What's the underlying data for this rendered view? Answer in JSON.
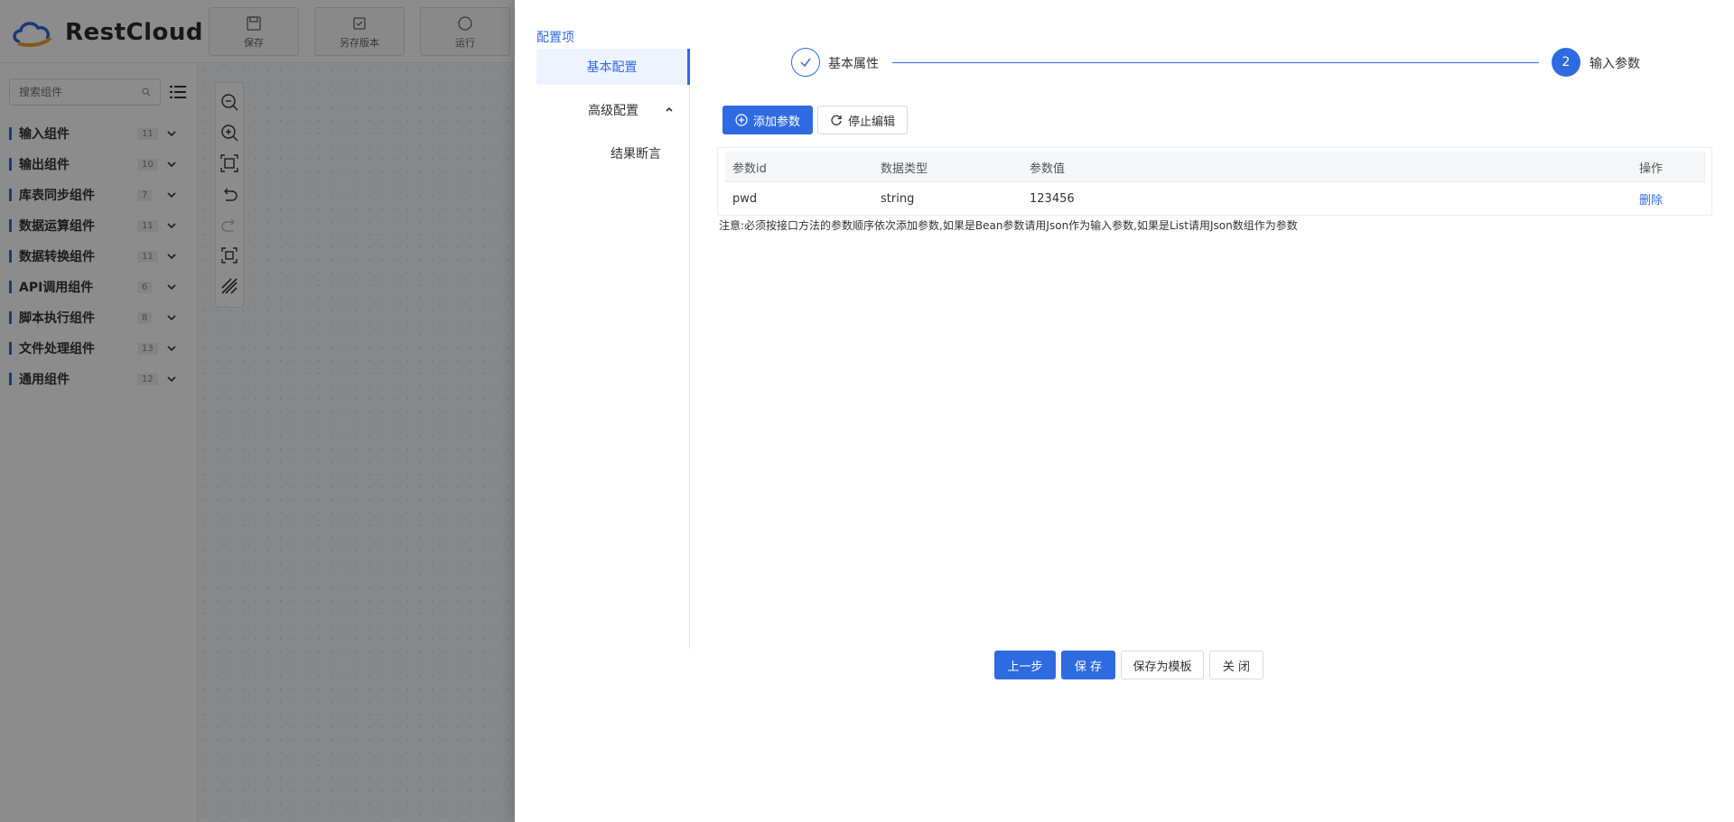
{
  "app": {
    "logo_text": "RestCloud",
    "toolbar": [
      {
        "label": "保存",
        "icon": "save-icon"
      },
      {
        "label": "另存版本",
        "icon": "save-version-icon"
      },
      {
        "label": "运行",
        "icon": "run-icon"
      }
    ],
    "search_placeholder": "搜索组件",
    "components": [
      {
        "label": "输入组件",
        "count": "11"
      },
      {
        "label": "输出组件",
        "count": "10"
      },
      {
        "label": "库表同步组件",
        "count": "7"
      },
      {
        "label": "数据运算组件",
        "count": "11"
      },
      {
        "label": "数据转换组件",
        "count": "11"
      },
      {
        "label": "API调用组件",
        "count": "6"
      },
      {
        "label": "脚本执行组件",
        "count": "8"
      },
      {
        "label": "文件处理组件",
        "count": "13"
      },
      {
        "label": "通用组件",
        "count": "12"
      }
    ],
    "canvas_tools": [
      "zoom-out-icon",
      "zoom-in-icon",
      "fit-icon",
      "undo-icon",
      "redo-icon",
      "fullscreen-icon",
      "grid-icon"
    ]
  },
  "drawer": {
    "title": "配置项",
    "nav": {
      "basic": "基本配置",
      "advanced": "高级配置",
      "assert": "结果断言"
    },
    "steps": [
      {
        "label": "基本属性",
        "status": "finished"
      },
      {
        "number": "2",
        "label": "输入参数",
        "status": "current"
      }
    ],
    "buttons": {
      "add_param": "添加参数",
      "stop_edit": "停止编辑",
      "prev": "上一步",
      "save": "保 存",
      "save_template": "保存为模板",
      "close": "关 闭"
    },
    "table": {
      "columns": [
        "参数id",
        "数据类型",
        "参数值",
        "操作"
      ],
      "rows": [
        {
          "id": "pwd",
          "type": "string",
          "value": "123456",
          "action": "删除"
        }
      ]
    },
    "note": "注意:必须按接口方法的参数顺序依次添加参数,如果是Bean参数请用Json作为输入参数,如果是List请用Json数组作为参数"
  },
  "colors": {
    "primary": "#2f6be0",
    "overlay": "rgba(0,0,0,0.45)"
  }
}
